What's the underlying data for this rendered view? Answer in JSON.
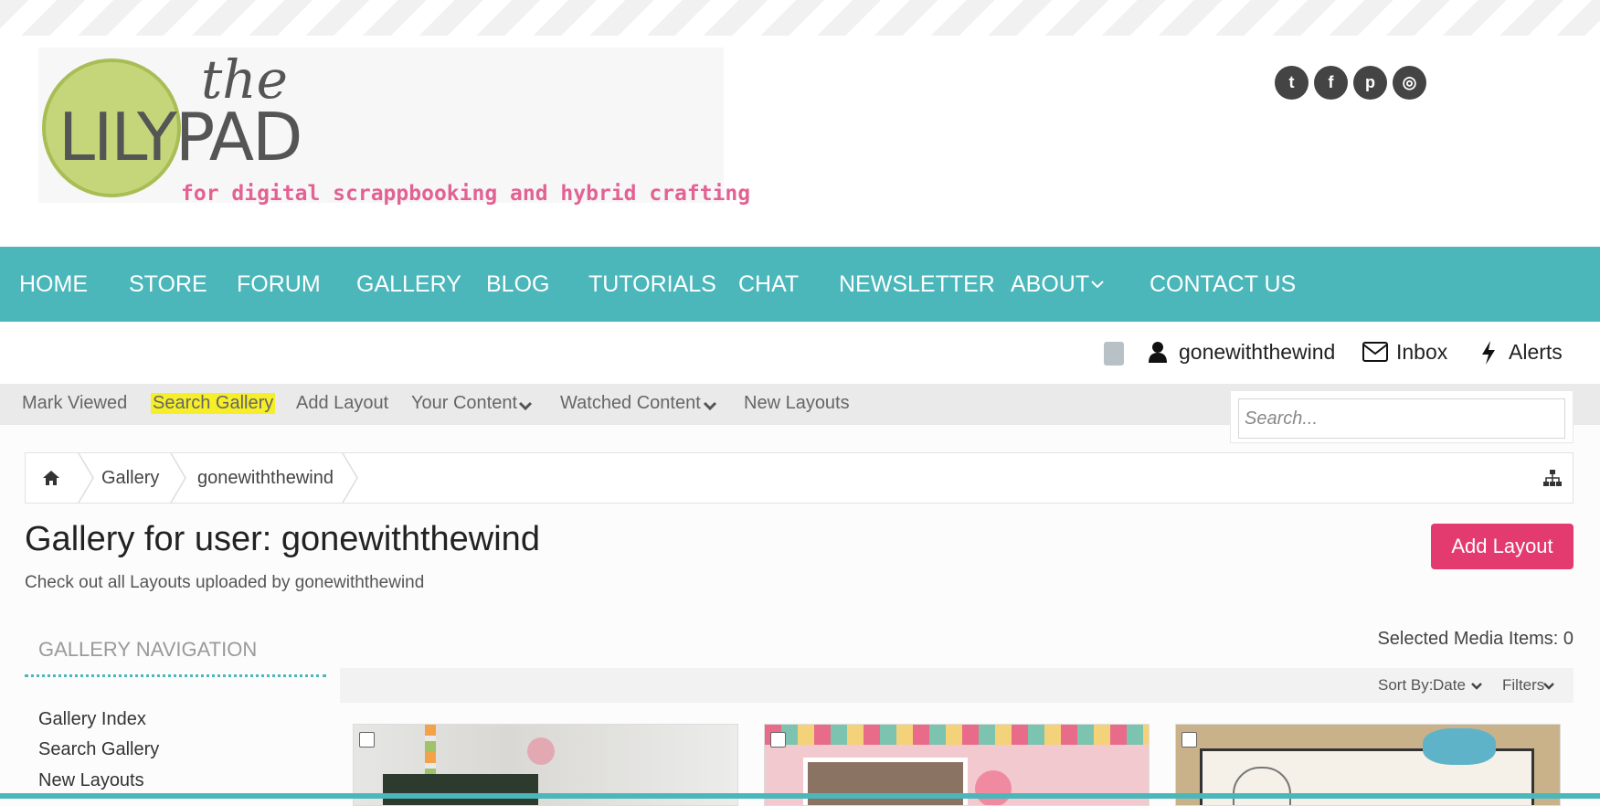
{
  "logo": {
    "the": "the",
    "lilypad": "LILYPAD",
    "tagline": "for digital scrappbooking and hybrid crafting"
  },
  "social": [
    {
      "name": "twitter-icon",
      "glyph": "t"
    },
    {
      "name": "facebook-icon",
      "glyph": "f"
    },
    {
      "name": "pinterest-icon",
      "glyph": "p"
    },
    {
      "name": "instagram-icon",
      "glyph": "◎"
    }
  ],
  "nav": {
    "home": "HOME",
    "store": "STORE",
    "forum": "FORUM",
    "gallery": "GALLERY",
    "blog": "BLOG",
    "tutorials": "TUTORIALS",
    "chat": "CHAT",
    "newsletter": "NEWSLETTER",
    "about": "ABOUT",
    "contact": "CONTACT US"
  },
  "user": {
    "username": "gonewiththewind",
    "inbox": "Inbox",
    "alerts": "Alerts"
  },
  "subnav": {
    "mark_viewed": "Mark Viewed",
    "search_gallery": "Search Gallery",
    "add_layout": "Add Layout",
    "your_content": "Your Content",
    "watched_content": "Watched Content",
    "new_layouts": "New Layouts"
  },
  "search": {
    "placeholder": "Search..."
  },
  "breadcrumb": {
    "gallery": "Gallery",
    "user": "gonewiththewind"
  },
  "page": {
    "title": "Gallery for user: gonewiththewind",
    "subtitle": "Check out all Layouts uploaded by gonewiththewind",
    "add_button": "Add Layout"
  },
  "gallery_nav": {
    "title": "GALLERY NAVIGATION",
    "items": [
      "Gallery Index",
      "Search Gallery",
      "New Layouts"
    ]
  },
  "media": {
    "selected": "Selected Media Items: 0",
    "sort_label": "Sort By:",
    "sort_value": "Date",
    "filters": "Filters"
  },
  "colors": {
    "teal": "#4bb7bb",
    "pink": "#e33b6f",
    "highlight": "#f5ee29",
    "logo_green": "#c5d67a"
  }
}
